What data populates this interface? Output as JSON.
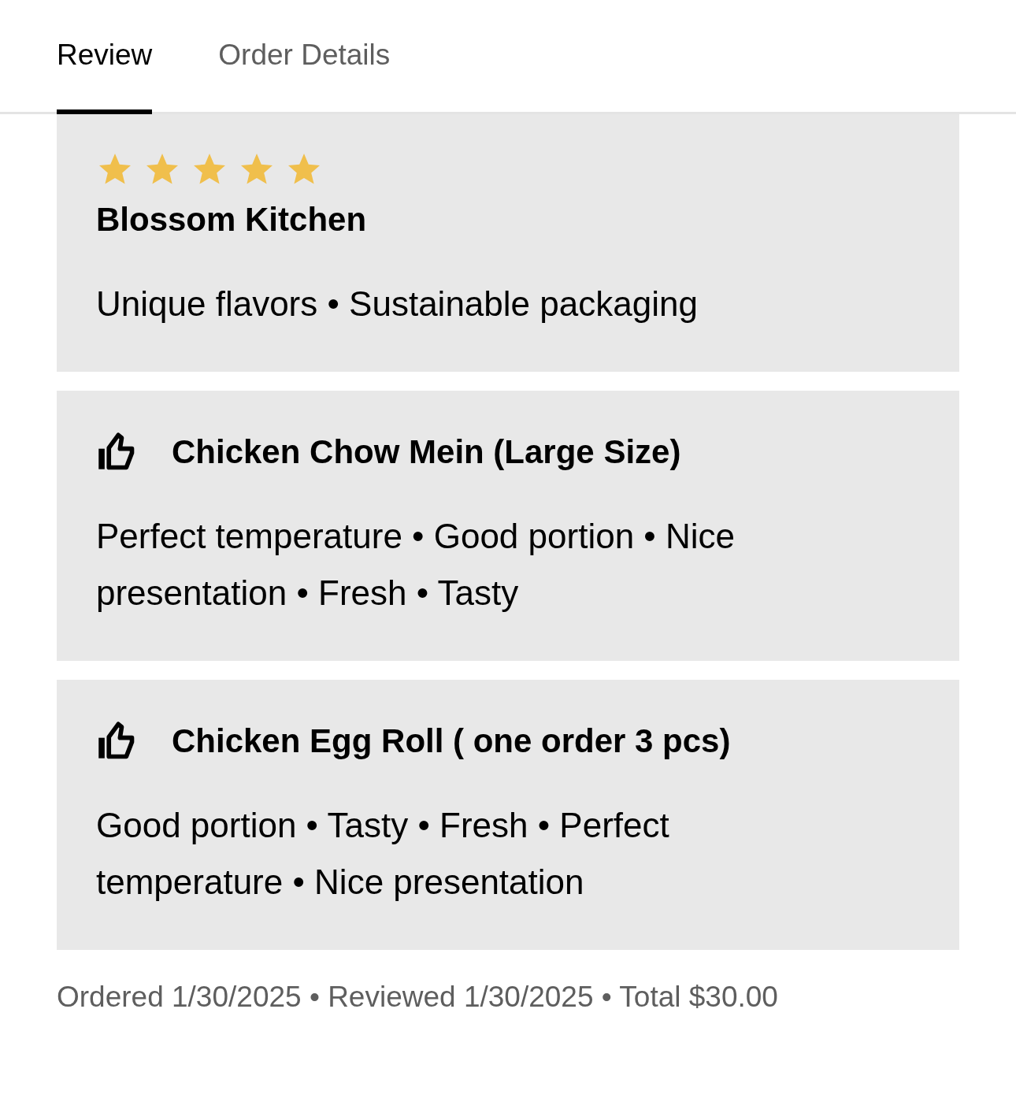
{
  "tabs": [
    {
      "label": "Review",
      "selected": true
    },
    {
      "label": "Order Details",
      "selected": false
    }
  ],
  "restaurant_review": {
    "stars": 5,
    "name": "Blossom Kitchen",
    "tags": "Unique flavors • Sustainable packaging"
  },
  "item_reviews": [
    {
      "name": "Chicken Chow Mein (Large Size)",
      "liked": true,
      "tags": "Perfect temperature • Good portion • Nice presentation • Fresh • Tasty"
    },
    {
      "name": "Chicken Egg Roll ( one order 3 pcs)",
      "liked": true,
      "tags": "Good portion • Tasty • Fresh • Perfect temperature • Nice presentation"
    }
  ],
  "footer": "Ordered 1/30/2025 • Reviewed 1/30/2025 • Total $30.00"
}
